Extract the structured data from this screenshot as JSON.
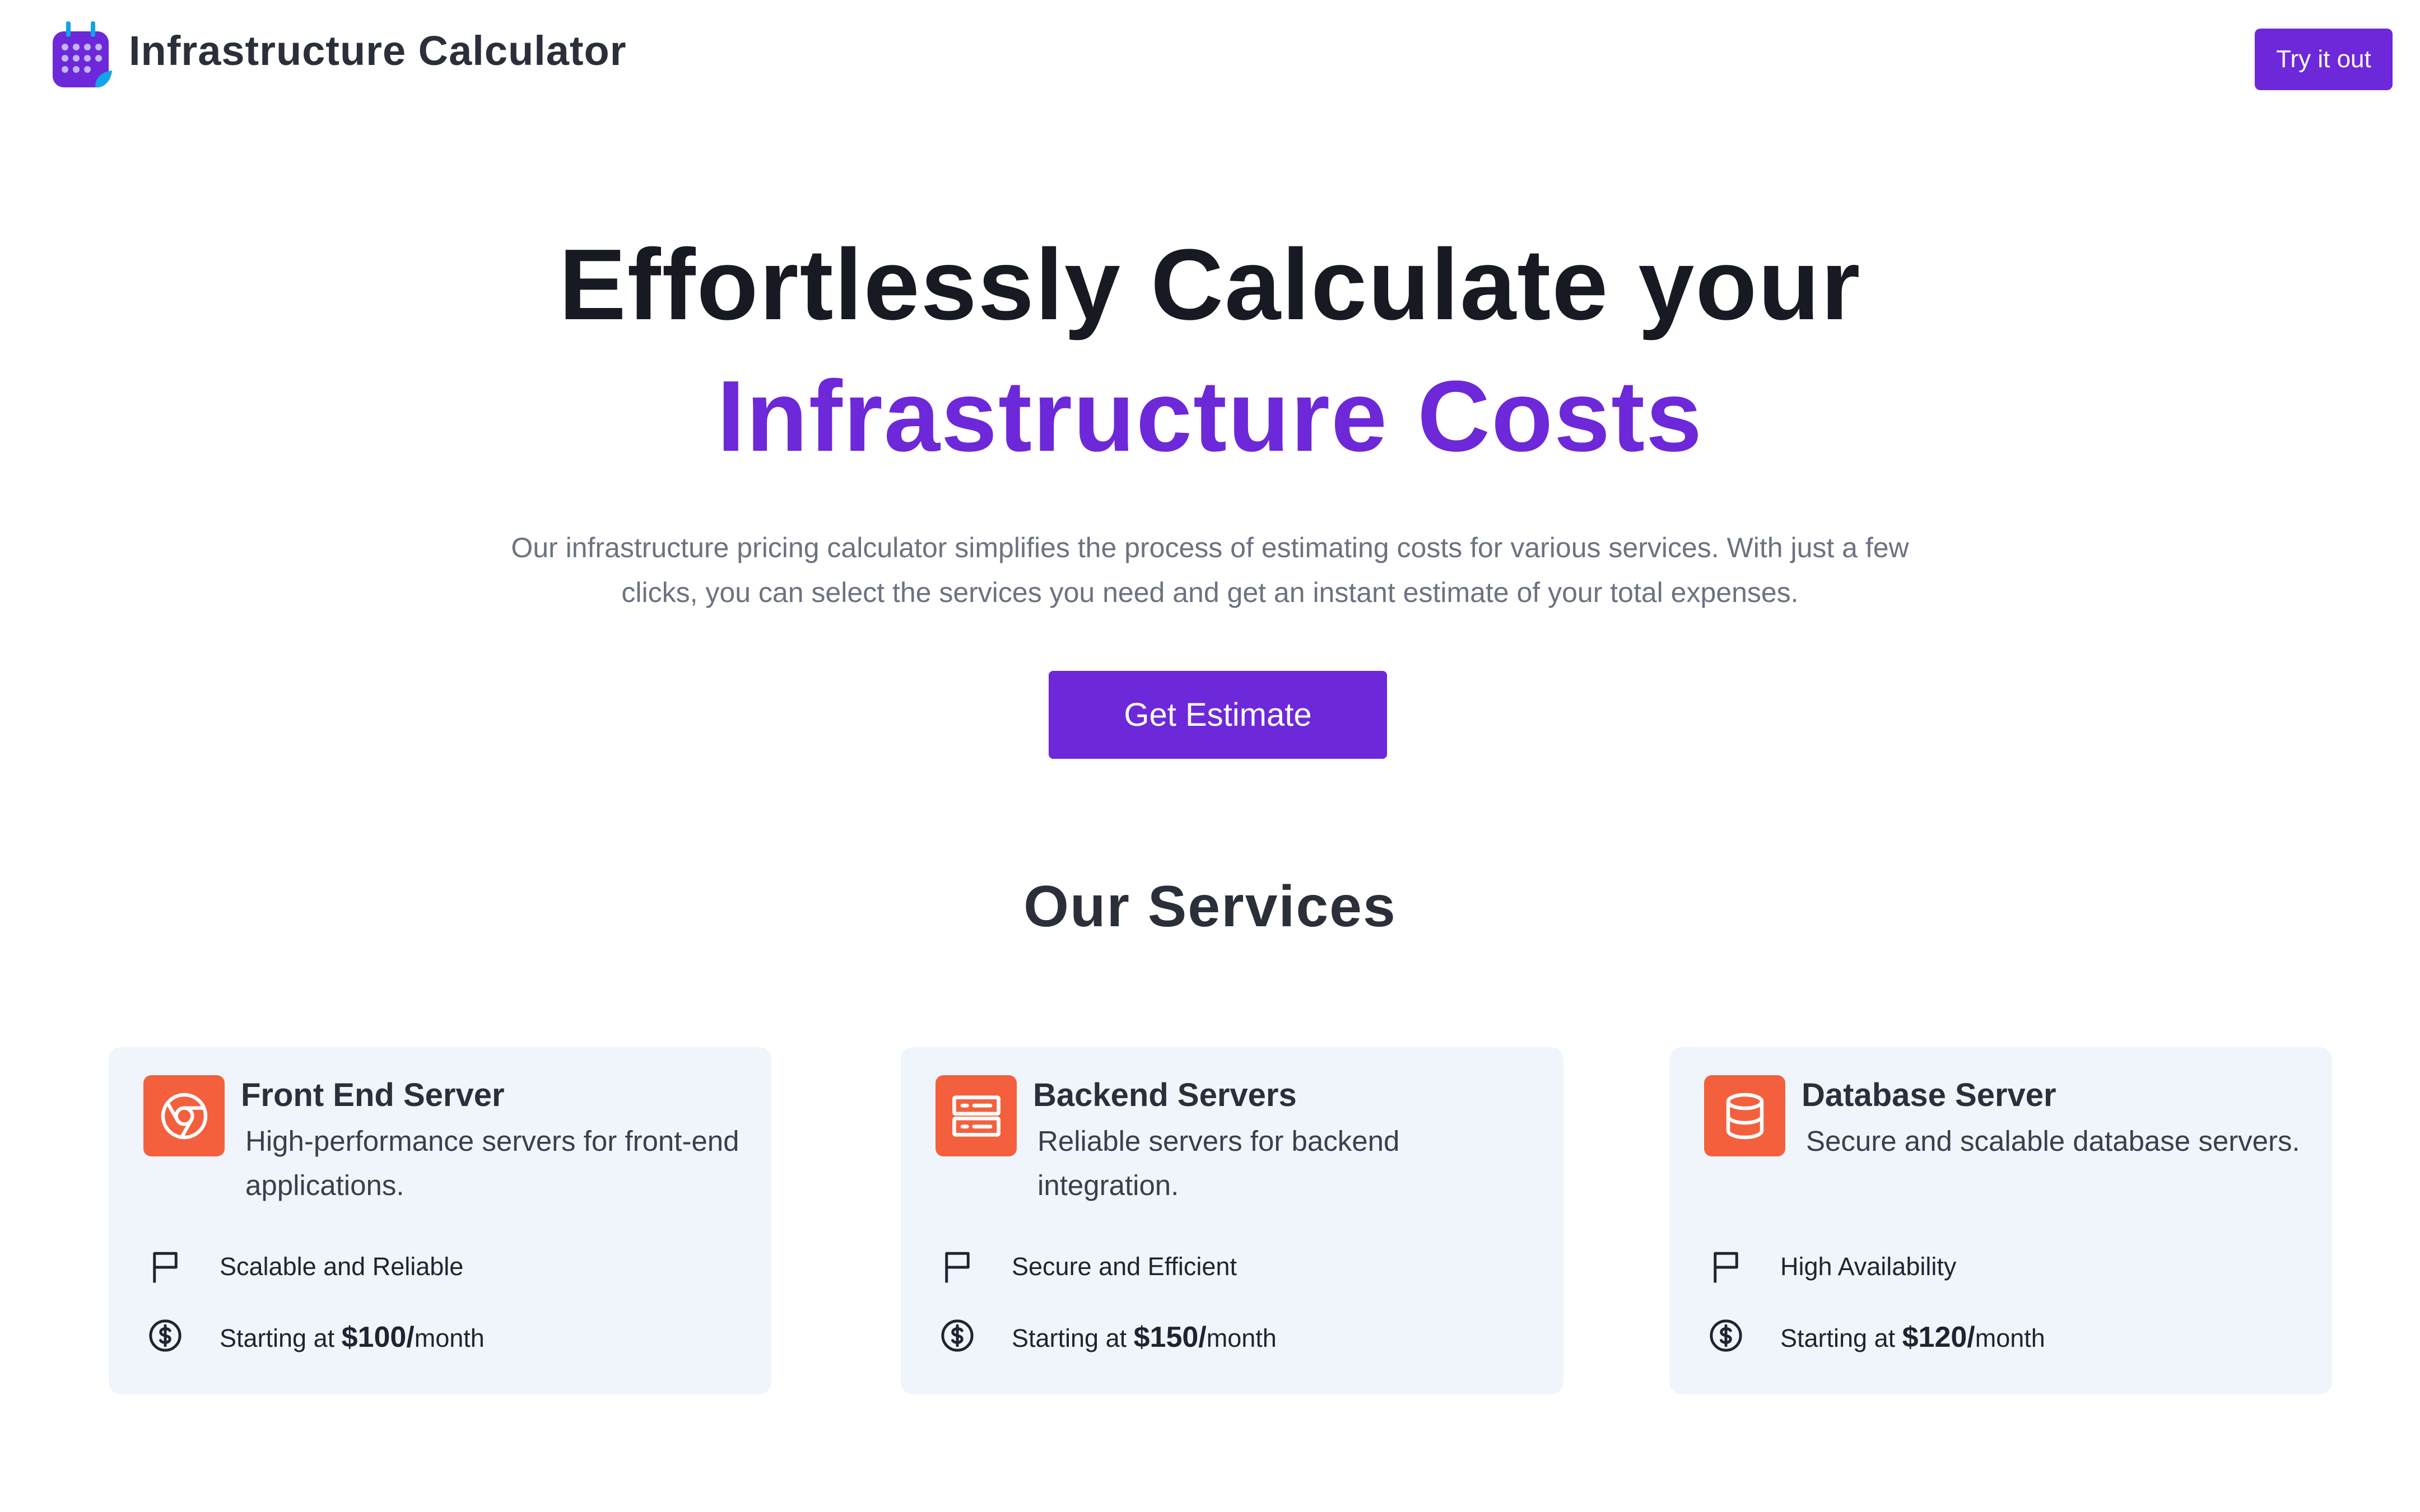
{
  "header": {
    "brand": "Infrastructure Calculator",
    "try_label": "Try it out"
  },
  "hero": {
    "title_line1": "Effortlessly Calculate your",
    "title_line2": "Infrastructure Costs",
    "description": "Our infrastructure pricing calculator simplifies the process of estimating costs for various services. With just a few clicks, you can select the services you need and get an instant estimate of your total expenses.",
    "cta_label": "Get Estimate"
  },
  "services": {
    "title": "Our Services",
    "cards": [
      {
        "icon": "chrome-icon",
        "title": "Front End Server",
        "description": "High-performance servers for front-end applications.",
        "feature": "Scalable and Reliable",
        "price_prefix": "Starting at ",
        "price": "$100/",
        "price_suffix": "month"
      },
      {
        "icon": "server-icon",
        "title": "Backend Servers",
        "description": "Reliable servers for backend integration.",
        "feature": "Secure and Efficient",
        "price_prefix": "Starting at ",
        "price": "$150/",
        "price_suffix": "month"
      },
      {
        "icon": "database-icon",
        "title": "Database Server",
        "description": "Secure and scalable database servers.",
        "feature": "High Availability",
        "price_prefix": "Starting at ",
        "price": "$120/",
        "price_suffix": "month"
      }
    ]
  },
  "colors": {
    "accent": "#6d28d9",
    "icon_bg": "#f4603d",
    "card_bg": "#eff5fb"
  }
}
